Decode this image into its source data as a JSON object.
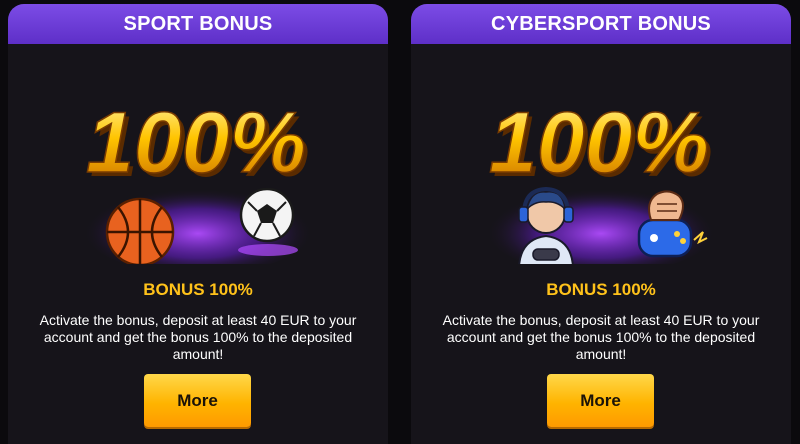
{
  "cards": [
    {
      "title": "SPORT BONUS",
      "hero_text": "100%",
      "bonus_label": "BONUS 100%",
      "description": "Activate the bonus, deposit at least 40 EUR to your account and get the bonus 100% to the deposited amount!",
      "button_label": "More",
      "icons": [
        "basketball-icon",
        "soccer-ball-icon"
      ]
    },
    {
      "title": "CYBERSPORT BONUS",
      "hero_text": "100%",
      "bonus_label": "BONUS 100%",
      "description": "Activate the bonus, deposit at least 40 EUR to your account and get the bonus 100% to the deposited amount!",
      "button_label": "More",
      "icons": [
        "gamer-icon",
        "gamepad-fist-icon"
      ]
    }
  ],
  "colors": {
    "header": "#6a3ad6",
    "accent": "#ffc21a",
    "button": "#ffb400",
    "card_bg": "#16141a"
  }
}
